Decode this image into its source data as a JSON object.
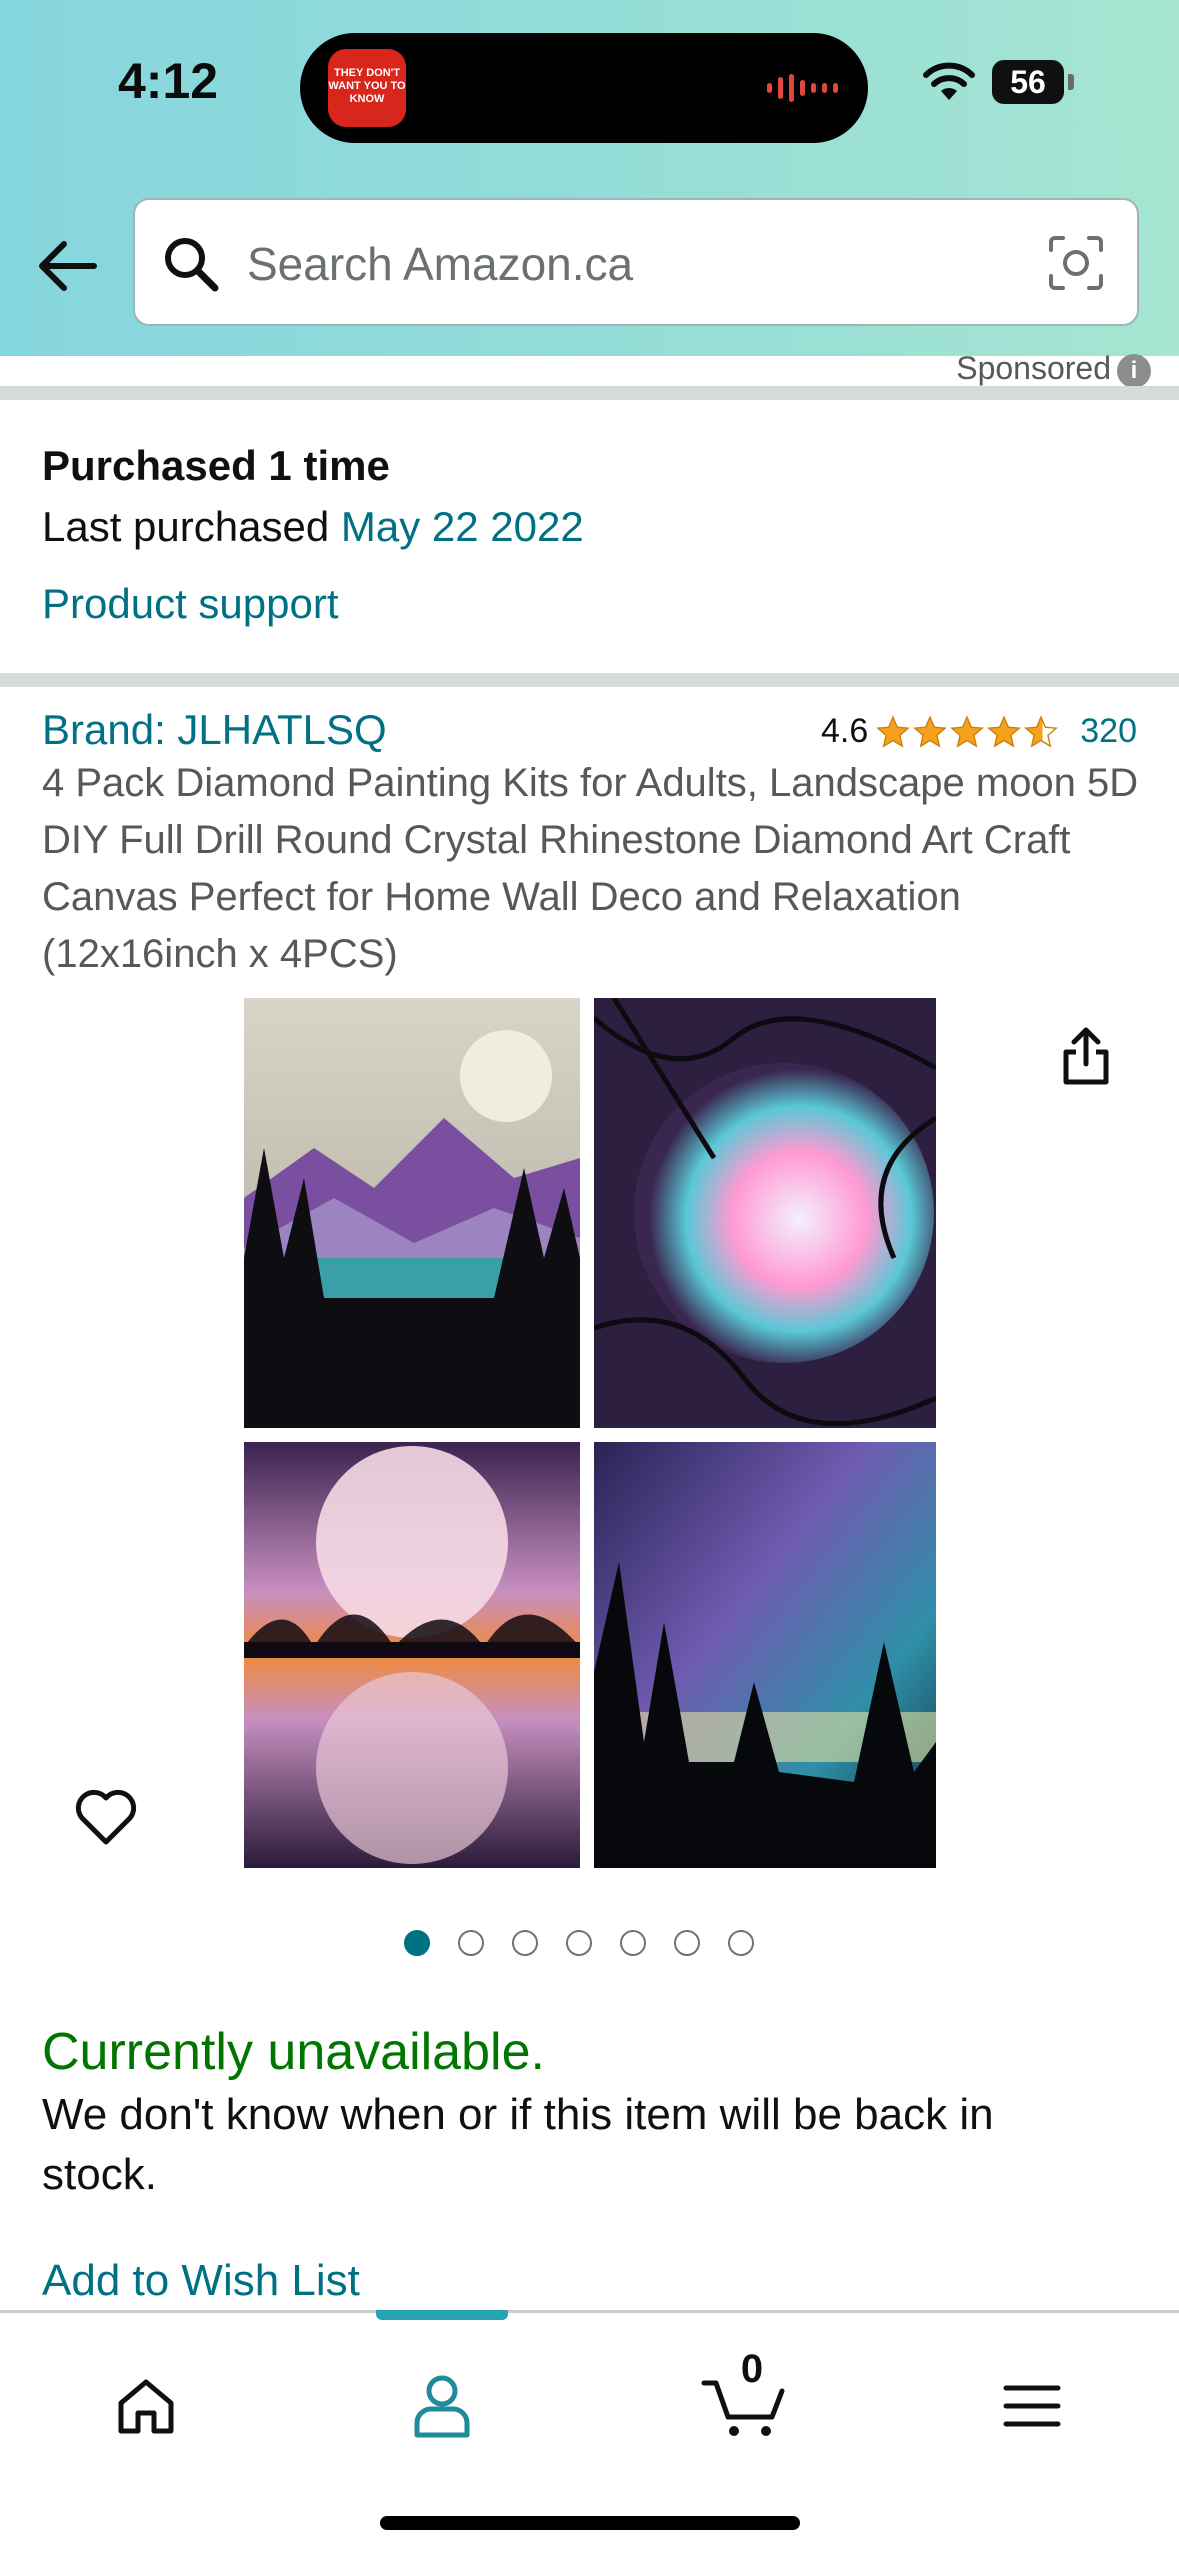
{
  "status_bar": {
    "time": "4:12",
    "battery": "56",
    "dynamic_island_app_text": "THEY DON'T WANT YOU TO KNOW"
  },
  "header": {
    "search_placeholder": "Search Amazon.ca",
    "sponsored": "Sponsored",
    "sponsored_info_glyph": "i"
  },
  "purchase_history": {
    "purchased_count": "Purchased 1 time",
    "last_purchased_label": "Last purchased",
    "last_purchased_date": "May 22 2022",
    "support_link": "Product support"
  },
  "product": {
    "brand": "Brand: JLHATLSQ",
    "rating": "4.6",
    "rating_stars": 4.6,
    "review_count": "320",
    "title": "4 Pack Diamond Painting Kits for Adults, Landscape moon 5D DIY Full Drill Round Crystal Rhinestone Diamond Art Craft Canvas Perfect for Home Wall Deco and Relaxation (12x16inch x 4PCS)",
    "image_count": 7,
    "active_image_index": 0
  },
  "availability": {
    "status": "Currently unavailable.",
    "message": "We don't know when or if this item will be back in stock.",
    "wishlist_link": "Add to Wish List"
  },
  "tab_bar": {
    "tabs": [
      "home-icon",
      "account-icon",
      "cart-icon",
      "menu-icon"
    ],
    "active_tab": "account-icon",
    "cart_count": "0"
  },
  "colors": {
    "link": "#007185",
    "available_green": "#007600",
    "star": "#f4a21b",
    "header_teal": "#93dcd7"
  }
}
